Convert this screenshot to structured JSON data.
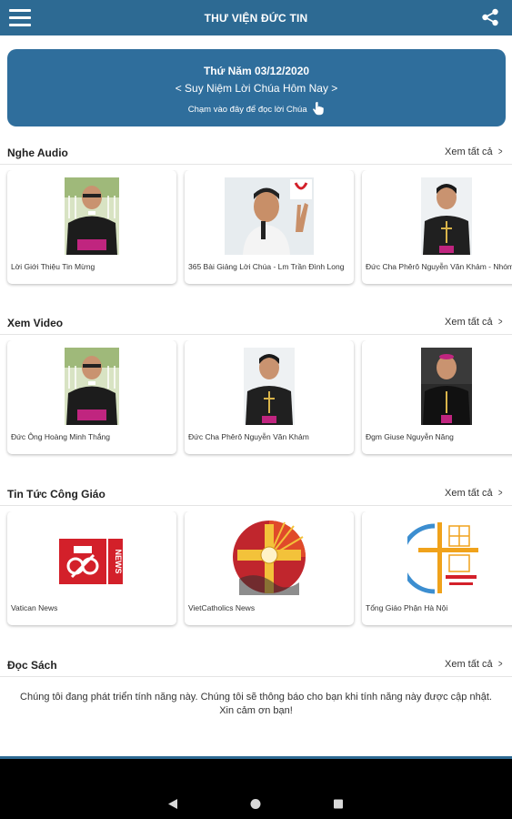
{
  "app": {
    "title": "THƯ VIỆN ĐỨC TIN"
  },
  "icons": {
    "menu": "hamburger-menu-icon",
    "share": "share-icon",
    "hand": "pointing-hand-icon"
  },
  "colors": {
    "primary": "#2d6a93",
    "banner": "#2f6e9c",
    "navbar": "#000000"
  },
  "banner": {
    "date": "Thứ Năm 03/12/2020",
    "reading": "< Suy Niệm Lời Chúa Hôm Nay >",
    "hint": "Chạm vào đây để đọc lời Chúa"
  },
  "sections": {
    "audio": {
      "title": "Nghe Audio",
      "see_all": "Xem tất cả",
      "items": [
        {
          "caption": "Lời Giới Thiệu Tin Mừng"
        },
        {
          "caption": "365 Bài Giảng Lời Chúa - Lm Trần Đình Long"
        },
        {
          "caption": "Đức Cha Phêrô Nguyễn Văn Khảm - Nhóm A"
        }
      ]
    },
    "video": {
      "title": "Xem Video",
      "see_all": "Xem tất cả",
      "items": [
        {
          "caption": "Đức Ông Hoàng Minh Thắng"
        },
        {
          "caption": "Đức Cha Phêrô Nguyễn Văn Khảm"
        },
        {
          "caption": "Đgm Giuse Nguyễn Năng"
        }
      ]
    },
    "news": {
      "title": "Tin Tức Công Giáo",
      "see_all": "Xem tất cả",
      "items": [
        {
          "caption": "Vatican News",
          "logo_text": "NEWS"
        },
        {
          "caption": "VietCatholics News"
        },
        {
          "caption": "Tổng Giáo Phận Hà Nội"
        }
      ]
    },
    "books": {
      "title": "Đọc Sách",
      "see_all": "Xem tất cả",
      "message": "Chúng tôi đang phát triển tính năng này. Chúng tôi sẽ thông báo cho bạn khi tính năng này được cập nhật. Xin cảm ơn bạn!"
    }
  },
  "system_nav": {
    "back": "back-triangle-icon",
    "home": "home-circle-icon",
    "recents": "recents-square-icon"
  }
}
